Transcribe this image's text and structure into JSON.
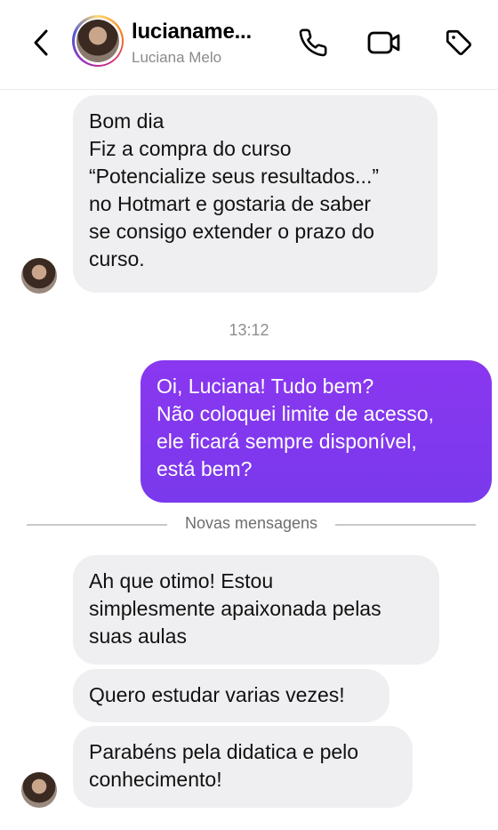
{
  "header": {
    "username": "lucianame...",
    "fullname": "Luciana Melo",
    "icons": [
      "back-chevron-icon",
      "phone-icon",
      "video-camera-icon",
      "tag-icon"
    ]
  },
  "messages": [
    {
      "sender": "incoming",
      "lines": [
        "Bom dia",
        "Fiz a compra do curso",
        "“Potencialize seus resultados...”",
        "no Hotmart e gostaria de saber",
        "se consigo extender o prazo do",
        "curso."
      ]
    },
    {
      "sender": "outgoing",
      "lines": [
        "Oi, Luciana! Tudo bem?",
        "Não coloquei limite de acesso,",
        "ele ficará sempre disponível,",
        "está bem?"
      ]
    },
    {
      "sender": "incoming",
      "lines": [
        "Ah que otimo! Estou",
        "simplesmente apaixonada pelas",
        "suas aulas"
      ]
    },
    {
      "sender": "incoming",
      "lines": [
        "Quero estudar varias vezes!"
      ]
    },
    {
      "sender": "incoming",
      "lines": [
        "Parabéns pela didatica e pelo",
        "conhecimento!"
      ]
    }
  ],
  "timestamp": "13:12",
  "new_messages_label": "Novas mensagens",
  "colors": {
    "outgoing_bubble": "#7f38ee",
    "incoming_bubble": "#efeff1"
  }
}
